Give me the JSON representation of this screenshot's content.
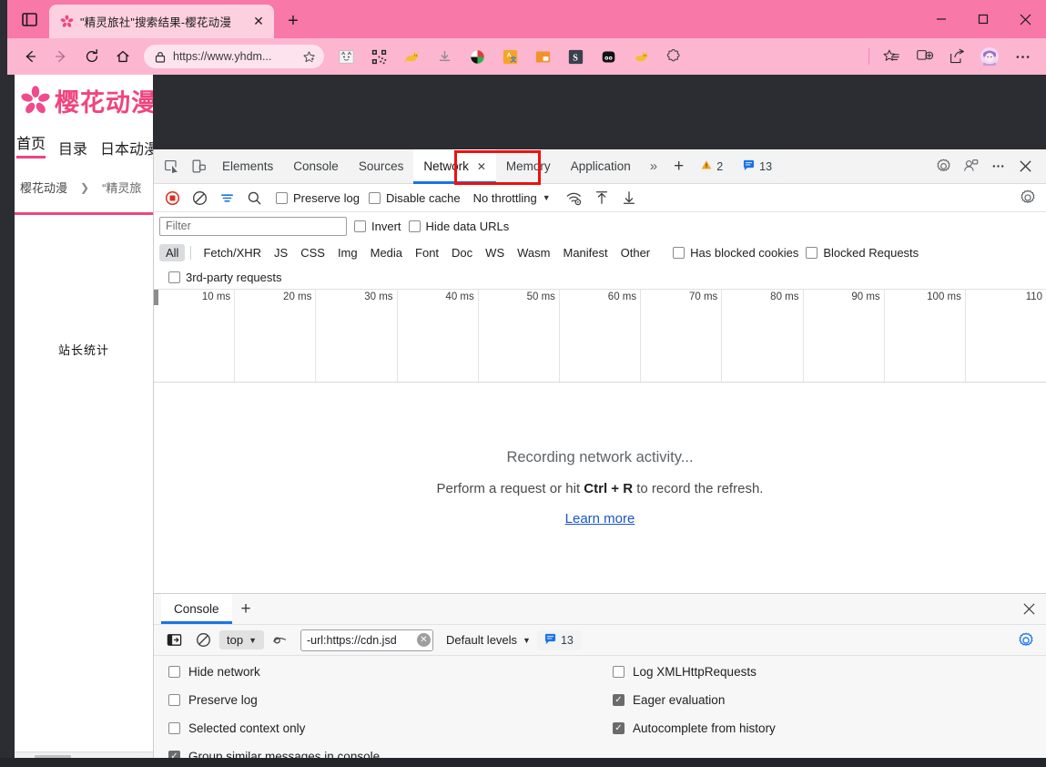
{
  "browser": {
    "tab": {
      "title": "\"精灵旅社\"搜索结果-樱花动漫",
      "close_label": "✕",
      "favicon": "sakura-icon"
    },
    "new_tab_label": "+",
    "window_controls": {
      "minimize": "minimize-icon",
      "maximize": "maximize-icon",
      "close": "close-icon"
    },
    "nav": {
      "back": "back-arrow-icon",
      "forward": "forward-arrow-icon",
      "reload": "reload-icon",
      "home": "home-icon",
      "url": "https://www.yhdm...",
      "lock": "lock-icon",
      "star": "favorite-star-icon"
    },
    "extensions": [
      "cat-face-extension-icon",
      "qr-code-extension-icon",
      "yellow-cat-extension-icon",
      "download-extension-icon",
      "color-wheel-extension-icon",
      "translate-extension-icon",
      "picture-in-picture-extension-icon",
      "s-logo-extension-icon",
      "panda-extension-icon",
      "yellow-cat2-extension-icon",
      "puzzle-extension-icon"
    ],
    "toolbar_right": [
      "collections-star-icon",
      "split-screen-icon",
      "share-icon",
      "profile-avatar-icon",
      "settings-more-icon"
    ]
  },
  "site": {
    "logo": "sakura-flower-icon",
    "name": "樱花动漫",
    "nav_items": [
      "首页",
      "目录",
      "日本动漫"
    ],
    "breadcrumb": {
      "root": "樱花动漫",
      "sep": "❯",
      "current": "“精灵旅"
    },
    "stat_text": "站长统计"
  },
  "devtools": {
    "left_icons": [
      "inspect-element-icon",
      "device-toolbar-icon"
    ],
    "tabs": [
      {
        "label": "Elements",
        "active": false
      },
      {
        "label": "Console",
        "active": false
      },
      {
        "label": "Sources",
        "active": false
      },
      {
        "label": "Network",
        "active": true,
        "close": "✕"
      },
      {
        "label": "Memory",
        "active": false
      },
      {
        "label": "Application",
        "active": false
      }
    ],
    "more_tabs": "»",
    "add_tab": "+",
    "warning_badge": {
      "icon": "warning-triangle-icon",
      "count": "2"
    },
    "message_badge": {
      "icon": "message-bubble-icon",
      "count": "13"
    },
    "right_icons": [
      "settings-gear-icon",
      "customize-devtools-icon",
      "more-options-icon",
      "close-devtools-icon"
    ],
    "network": {
      "toolbar": {
        "record": "record-stop-icon",
        "clear": "clear-icon",
        "filter": "filter-icon",
        "search": "search-icon",
        "preserve_log": {
          "label": "Preserve log",
          "checked": false
        },
        "disable_cache": {
          "label": "Disable cache",
          "checked": false
        },
        "throttling": "No throttling",
        "wifi_icon": "network-conditions-icon",
        "import_icon": "import-har-icon",
        "export_icon": "export-har-icon",
        "settings_icon": "network-settings-gear-icon"
      },
      "filter_placeholder": "Filter",
      "filter_value": "",
      "invert": {
        "label": "Invert",
        "checked": false
      },
      "hide_data_urls": {
        "label": "Hide data URLs",
        "checked": false
      },
      "types": [
        "All",
        "Fetch/XHR",
        "JS",
        "CSS",
        "Img",
        "Media",
        "Font",
        "Doc",
        "WS",
        "Wasm",
        "Manifest",
        "Other"
      ],
      "selected_type": "All",
      "has_blocked_cookies": {
        "label": "Has blocked cookies",
        "checked": false
      },
      "blocked_requests": {
        "label": "Blocked Requests",
        "checked": false
      },
      "third_party": {
        "label": "3rd-party requests",
        "checked": false
      },
      "timeline_ticks": [
        "10 ms",
        "20 ms",
        "30 ms",
        "40 ms",
        "50 ms",
        "60 ms",
        "70 ms",
        "80 ms",
        "90 ms",
        "100 ms",
        "110"
      ],
      "empty_state": {
        "heading": "Recording network activity...",
        "line_prefix": "Perform a request or hit ",
        "shortcut": "Ctrl + R",
        "line_suffix": " to record the refresh.",
        "link": "Learn more"
      }
    },
    "drawer": {
      "tab_label": "Console",
      "add_label": "+",
      "close": "close-drawer-icon",
      "toolbar": {
        "sidebar_icon": "console-sidebar-icon",
        "clear_icon": "clear-console-icon",
        "context": "top",
        "eye_icon": "live-expression-icon",
        "filter_value": "-url:https://cdn.jsd",
        "clear_filter": "✕",
        "levels": "Default levels",
        "message_badge": {
          "icon": "message-bubble-icon",
          "count": "13"
        },
        "settings_icon": "console-settings-gear-icon"
      },
      "settings": {
        "left": [
          {
            "label": "Hide network",
            "checked": false
          },
          {
            "label": "Preserve log",
            "checked": false
          },
          {
            "label": "Selected context only",
            "checked": false
          },
          {
            "label": "Group similar messages in console",
            "checked": true
          }
        ],
        "right": [
          {
            "label": "Log XMLHttpRequests",
            "checked": false
          },
          {
            "label": "Eager evaluation",
            "checked": true
          },
          {
            "label": "Autocomplete from history",
            "checked": true
          }
        ]
      }
    }
  },
  "colors": {
    "title_bar": "#f878a8",
    "nav_bar": "#fcb6d0",
    "tab_bg": "#fdd0e0",
    "accent_pink": "#f0447f",
    "devtools_accent": "#1a73e8",
    "highlight_red": "#ef1010"
  }
}
